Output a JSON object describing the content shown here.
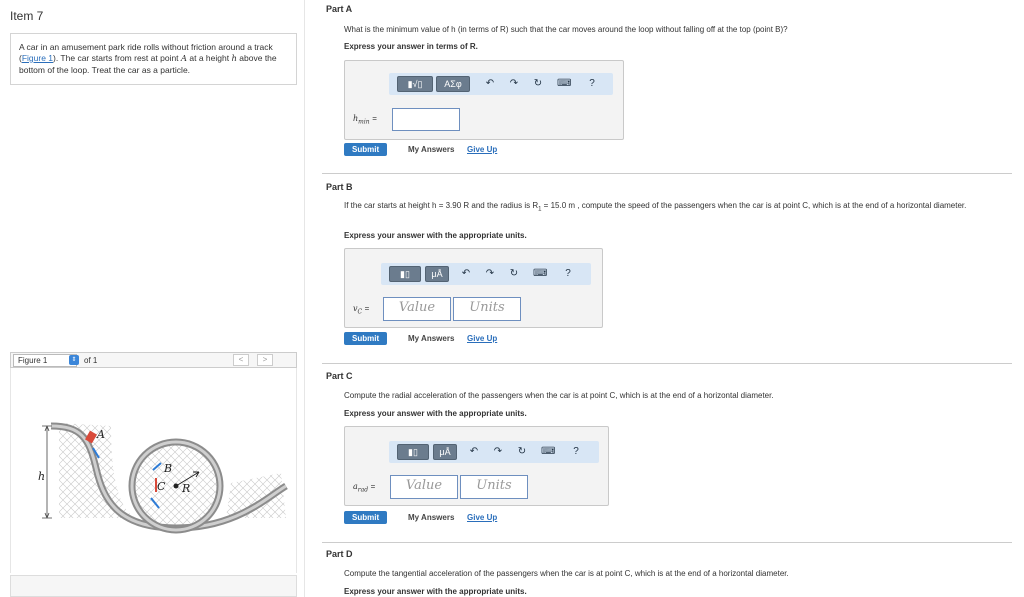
{
  "left": {
    "item_title": "Item 7",
    "problem": {
      "text_1": "A car in an amusement park ride rolls without friction around a track (",
      "figure_link": "Figure 1",
      "text_2": "). The car starts from rest at point ",
      "point_a": "A",
      "text_3": " at a height ",
      "var_h": "h",
      "text_4": " above the bottom of the loop. Treat the car as a particle."
    },
    "figure_nav": {
      "select_value": "Figure 1",
      "of_label": "of 1",
      "prev": "<",
      "next": ">"
    },
    "figure_labels": {
      "A": "A",
      "B": "B",
      "C": "C",
      "R": "R",
      "h": "h"
    }
  },
  "parts": [
    {
      "title": "Part A",
      "question": "What is the minimum value of h (in terms of R) such that the car moves around the loop without falling off at the top (point B)?",
      "instruction": "Express your answer in terms of R.",
      "toolbar": {
        "templates": "▮√▯",
        "symbols": "ΑΣφ",
        "undo": "↶",
        "redo": "↷",
        "reset": "↻",
        "keyboard": "⌨",
        "help": "?"
      },
      "var_label": "h",
      "var_sub": "min",
      "input_value": "",
      "submit": "Submit",
      "my_answers": "My Answers",
      "give_up": "Give Up"
    },
    {
      "title": "Part B",
      "question_1": "If the car starts at height h = 3.90 R and the radius is R",
      "question_sub": "1",
      "question_2": " = 15.0  m , compute the speed of the passengers when the car is at point C, which is at the end of a horizontal diameter.",
      "instruction": "Express your answer with the appropriate units.",
      "toolbar": {
        "templates": "▮▯",
        "units": "μÅ",
        "undo": "↶",
        "redo": "↷",
        "reset": "↻",
        "keyboard": "⌨",
        "help": "?"
      },
      "var_label": "v",
      "var_sub": "C",
      "value_placeholder": "Value",
      "units_placeholder": "Units",
      "submit": "Submit",
      "my_answers": "My Answers",
      "give_up": "Give Up"
    },
    {
      "title": "Part C",
      "question": "Compute the radial acceleration of the passengers when the car is at point C, which is at the end of a horizontal diameter.",
      "instruction": "Express your answer with the appropriate units.",
      "toolbar": {
        "templates": "▮▯",
        "units": "μÅ",
        "undo": "↶",
        "redo": "↷",
        "reset": "↻",
        "keyboard": "⌨",
        "help": "?"
      },
      "var_label": "a",
      "var_sub": "rad",
      "value_placeholder": "Value",
      "units_placeholder": "Units",
      "submit": "Submit",
      "my_answers": "My Answers",
      "give_up": "Give Up"
    },
    {
      "title": "Part D",
      "question": "Compute the tangential acceleration of the passengers when the car is at point C, which is at the end of a horizontal diameter.",
      "instruction": "Express your answer with the appropriate units."
    }
  ]
}
